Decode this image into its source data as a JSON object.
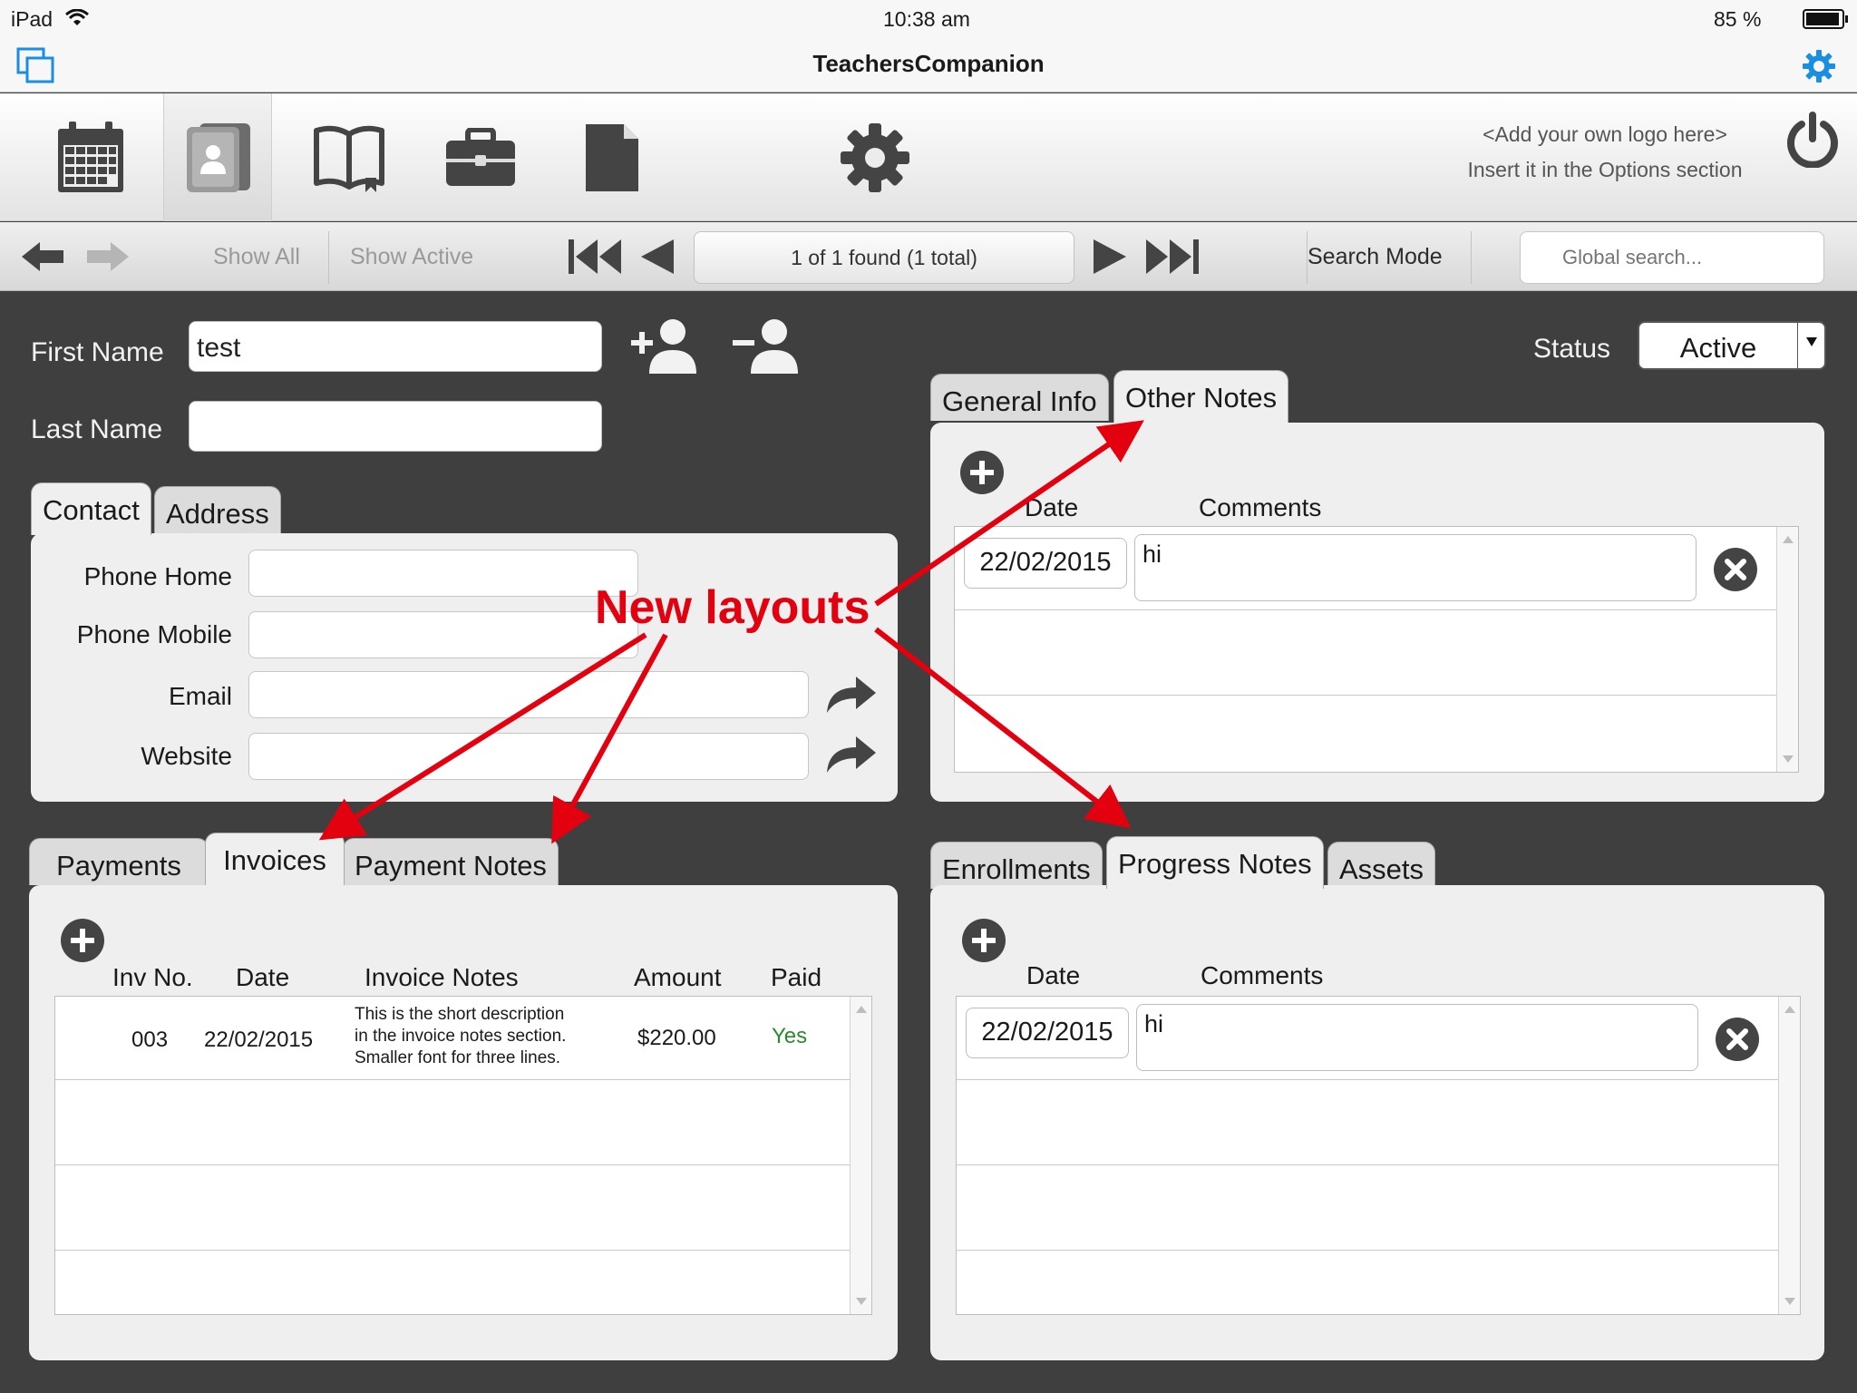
{
  "status_bar": {
    "device": "iPad",
    "time": "10:38 am",
    "battery": "85 %"
  },
  "app": {
    "title": "TeachersCompanion"
  },
  "toolbar": {
    "buttons": [
      {
        "icon": "calendar-icon"
      },
      {
        "icon": "contacts-icon",
        "active": true
      },
      {
        "icon": "book-icon"
      },
      {
        "icon": "briefcase-icon"
      },
      {
        "icon": "document-icon"
      },
      {
        "icon": "gear-icon"
      }
    ],
    "logo_line1": "<Add your own logo here>",
    "logo_line2": "Insert it in the Options section"
  },
  "nav": {
    "show_all": "Show All",
    "show_active": "Show Active",
    "found": "1 of 1 found (1 total)",
    "search_mode": "Search Mode",
    "global_search_placeholder": "Global search..."
  },
  "record": {
    "first_name_label": "First Name",
    "first_name_value": "test",
    "last_name_label": "Last Name",
    "last_name_value": "",
    "status_label": "Status",
    "status_value": "Active"
  },
  "contact_panel": {
    "tabs": [
      "Contact",
      "Address"
    ],
    "active_tab": "Contact",
    "fields": [
      {
        "label": "Phone Home",
        "value": ""
      },
      {
        "label": "Phone Mobile",
        "value": ""
      },
      {
        "label": "Email",
        "value": ""
      },
      {
        "label": "Website",
        "value": ""
      }
    ]
  },
  "notes_panel": {
    "tabs": [
      "General Info",
      "Other Notes"
    ],
    "active_tab": "Other Notes",
    "columns": [
      "Date",
      "Comments"
    ],
    "rows": [
      {
        "date": "22/02/2015",
        "comment": "hi"
      }
    ]
  },
  "invoices_panel": {
    "tabs": [
      "Payments",
      "Invoices",
      "Payment Notes"
    ],
    "active_tab": "Invoices",
    "columns": [
      "Inv No.",
      "Date",
      "Invoice Notes",
      "Amount",
      "Paid"
    ],
    "rows": [
      {
        "inv_no": "003",
        "date": "22/02/2015",
        "notes_line1": "This is the short description",
        "notes_line2": "in the invoice notes section.",
        "notes_line3": "Smaller font for three lines.",
        "amount": "$220.00",
        "paid": "Yes"
      }
    ]
  },
  "progress_panel": {
    "tabs": [
      "Enrollments",
      "Progress Notes",
      "Assets"
    ],
    "active_tab": "Progress Notes",
    "columns": [
      "Date",
      "Comments"
    ],
    "rows": [
      {
        "date": "22/02/2015",
        "comment": "hi"
      }
    ]
  },
  "annotation": {
    "text": "New layouts",
    "color": "#e3000f"
  },
  "colors": {
    "background": "#3f3f3f",
    "paid_yes": "#2a8a2a",
    "accent_blue": "#1a8ee0"
  }
}
